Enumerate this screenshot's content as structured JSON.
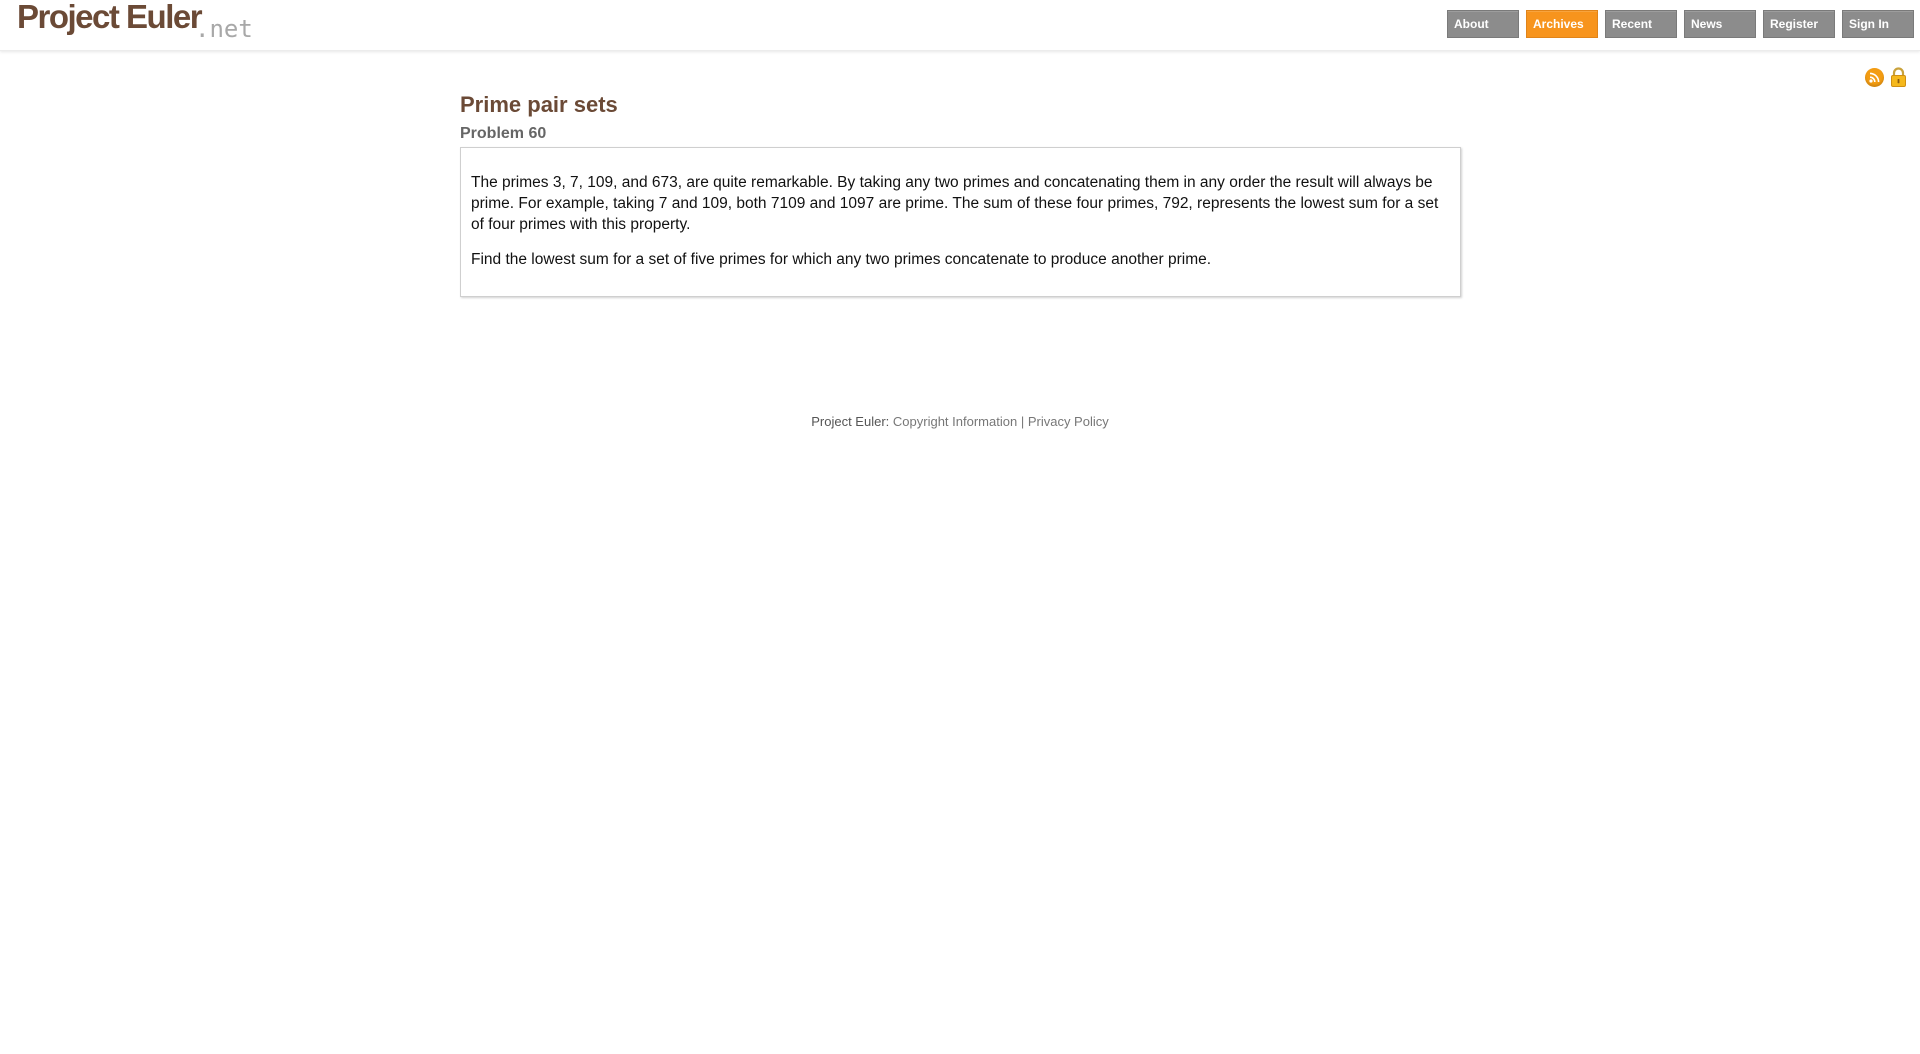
{
  "header": {
    "logo_text": "Project Euler",
    "logo_tld": ".net",
    "nav": [
      {
        "label": "About",
        "active": false
      },
      {
        "label": "Archives",
        "active": true
      },
      {
        "label": "Recent",
        "active": false
      },
      {
        "label": "News",
        "active": false
      },
      {
        "label": "Register",
        "active": false
      },
      {
        "label": "Sign In",
        "active": false
      }
    ],
    "icons": [
      "rss-icon",
      "lock-icon"
    ]
  },
  "problem": {
    "title": "Prime pair sets",
    "number": "Problem 60",
    "paragraphs": [
      "The primes 3, 7, 109, and 673, are quite remarkable. By taking any two primes and concatenating them in any order the result will always be prime. For example, taking 7 and 109, both 7109 and 1097 are prime. The sum of these four primes, 792, represents the lowest sum for a set of four primes with this property.",
      "Find the lowest sum for a set of five primes for which any two primes concatenate to produce another prime."
    ]
  },
  "footer": {
    "prefix": "Project Euler:",
    "copyright_link": "Copyright Information",
    "separator": "|",
    "privacy_link": "Privacy Policy"
  },
  "colors": {
    "brand": "#6b4a36",
    "nav_bg": "#8c8c8c",
    "nav_active": "#f7941d"
  }
}
